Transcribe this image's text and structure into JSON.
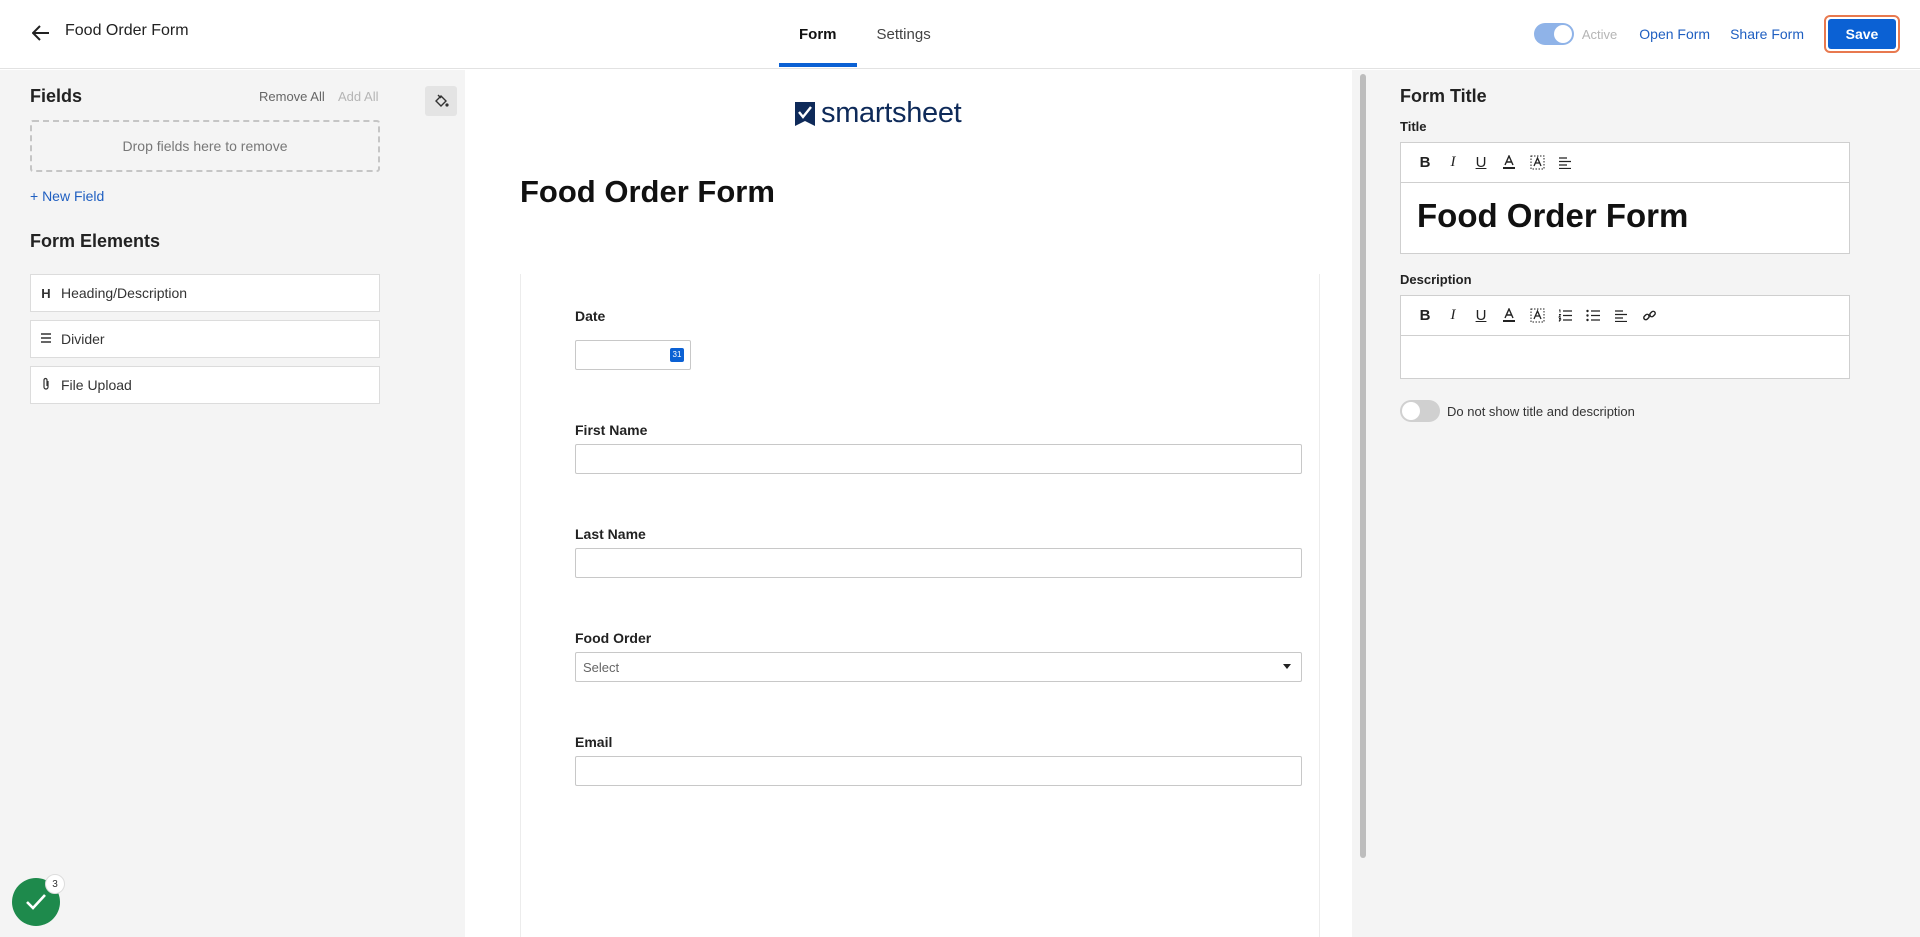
{
  "header": {
    "title": "Food Order Form",
    "tabs": [
      {
        "label": "Form",
        "active": true
      },
      {
        "label": "Settings",
        "active": false
      }
    ],
    "active_label": "Active",
    "active_on": true,
    "open_form_label": "Open Form",
    "share_form_label": "Share Form",
    "save_label": "Save"
  },
  "left_panel": {
    "fields_title": "Fields",
    "remove_all_label": "Remove All",
    "add_all_label": "Add All",
    "dropzone_text": "Drop fields here to remove",
    "new_field_label": "+ New Field",
    "elements_title": "Form Elements",
    "elements": [
      {
        "label": "Heading/Description",
        "icon": "heading-icon",
        "glyph": "H"
      },
      {
        "label": "Divider",
        "icon": "divider-icon",
        "glyph": "☰"
      },
      {
        "label": "File Upload",
        "icon": "paperclip-icon",
        "glyph": "⌀"
      }
    ],
    "badge_count": "3"
  },
  "form": {
    "logo_text": "smartsheet",
    "heading": "Food Order Form",
    "fields": [
      {
        "label": "Date",
        "type": "date"
      },
      {
        "label": "First Name",
        "type": "text"
      },
      {
        "label": "Last Name",
        "type": "text"
      },
      {
        "label": "Food Order",
        "type": "select",
        "placeholder": "Select"
      },
      {
        "label": "Email",
        "type": "text"
      }
    ]
  },
  "right_panel": {
    "section_title": "Form Title",
    "title_label": "Title",
    "title_value": "Food Order Form",
    "description_label": "Description",
    "description_value": "",
    "hide_label": "Do not show title and description",
    "hide_on": false
  },
  "colors": {
    "accent": "#0b61d4",
    "save_outline": "#e8794f",
    "success": "#1e8a4c",
    "link": "#1f5fc1"
  }
}
